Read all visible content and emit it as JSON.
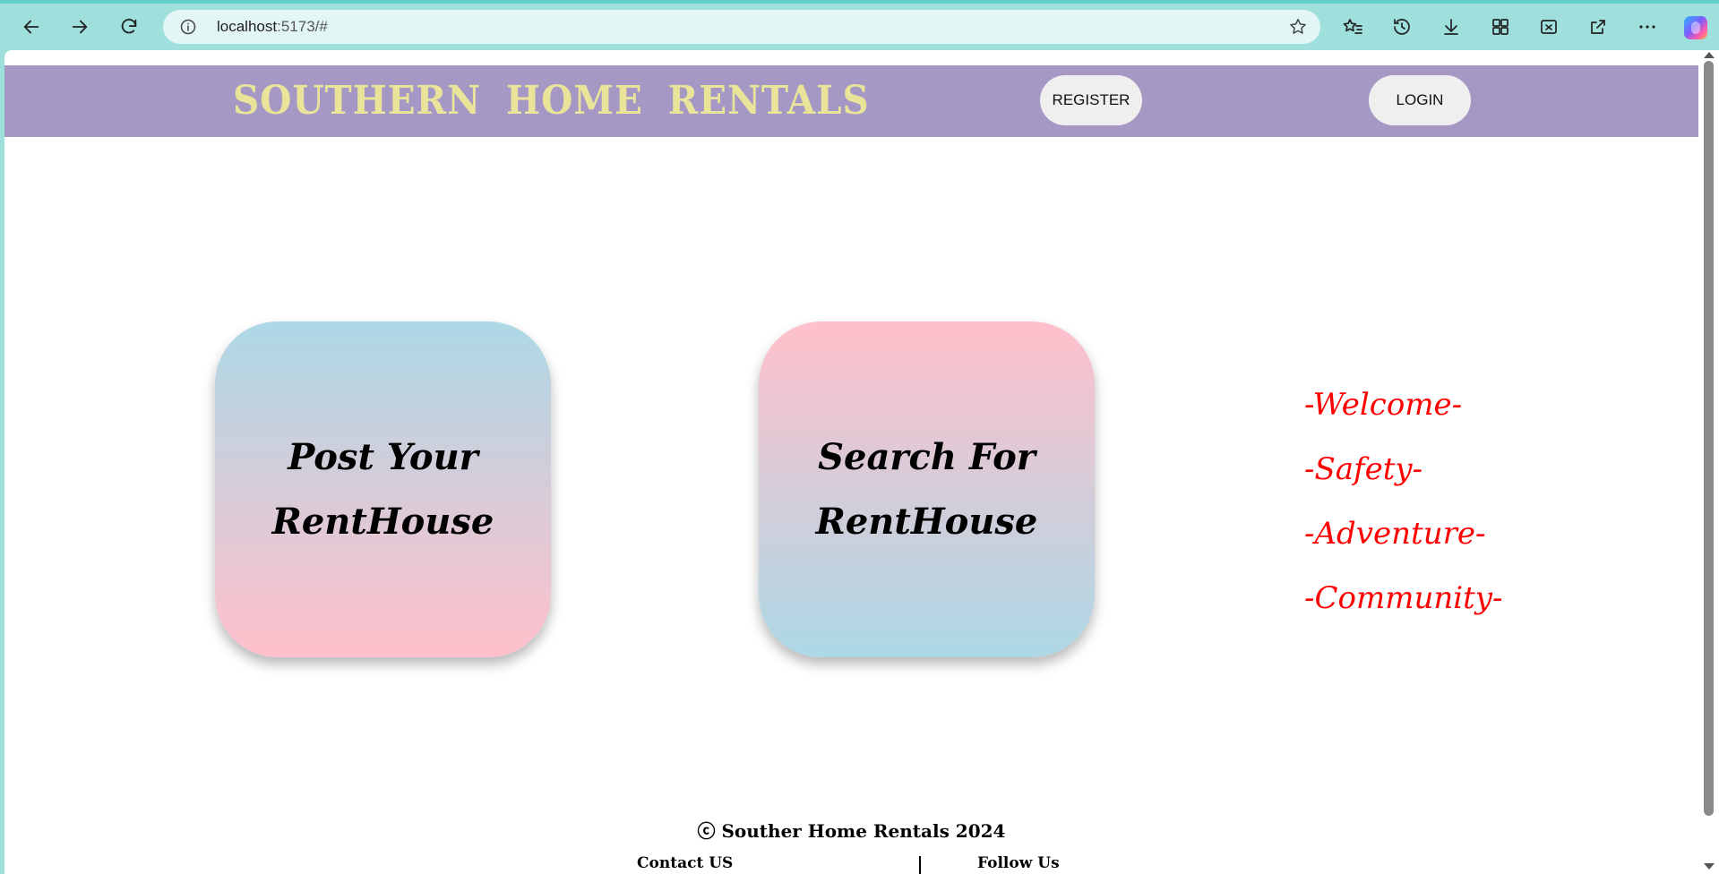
{
  "browser": {
    "url_host": "localhost",
    "url_path": ":5173/#"
  },
  "header": {
    "brand": "SOUTHERN HOME RENTALS",
    "register_label": "REGISTER",
    "login_label": "LOGIN",
    "background": "#a598c5",
    "brand_color": "#e9e49a"
  },
  "cards": {
    "post": {
      "line1": "Post Your",
      "line2": "RentHouse"
    },
    "search": {
      "line1": "Search For",
      "line2": "RentHouse"
    }
  },
  "taglines": [
    "-Welcome-",
    "-Safety-",
    "-Adventure-",
    "-Community-"
  ],
  "tagline_color": "#ff0000",
  "footer": {
    "copyright": "ⓒ Souther Home Rentals 2024",
    "contact": "Contact US",
    "follow": "Follow Us"
  }
}
